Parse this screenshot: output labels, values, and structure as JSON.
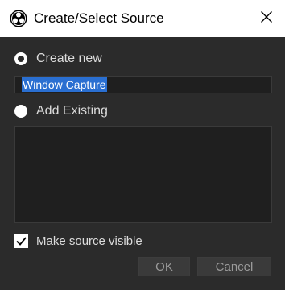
{
  "window": {
    "title": "Create/Select Source",
    "app_icon": "obs-logo-icon",
    "close_icon": "close-icon"
  },
  "options": {
    "create_new_label": "Create new",
    "create_new_selected": true,
    "source_name_value": "Window Capture",
    "add_existing_label": "Add Existing",
    "add_existing_selected": false,
    "existing_sources": []
  },
  "visibility": {
    "label": "Make source visible",
    "checked": true
  },
  "buttons": {
    "ok_label": "OK",
    "cancel_label": "Cancel"
  },
  "colors": {
    "titlebar_bg": "#ffffff",
    "dialog_bg": "#2b2b2b",
    "field_bg": "#1f1f1f",
    "selection": "#2a6fd1"
  }
}
